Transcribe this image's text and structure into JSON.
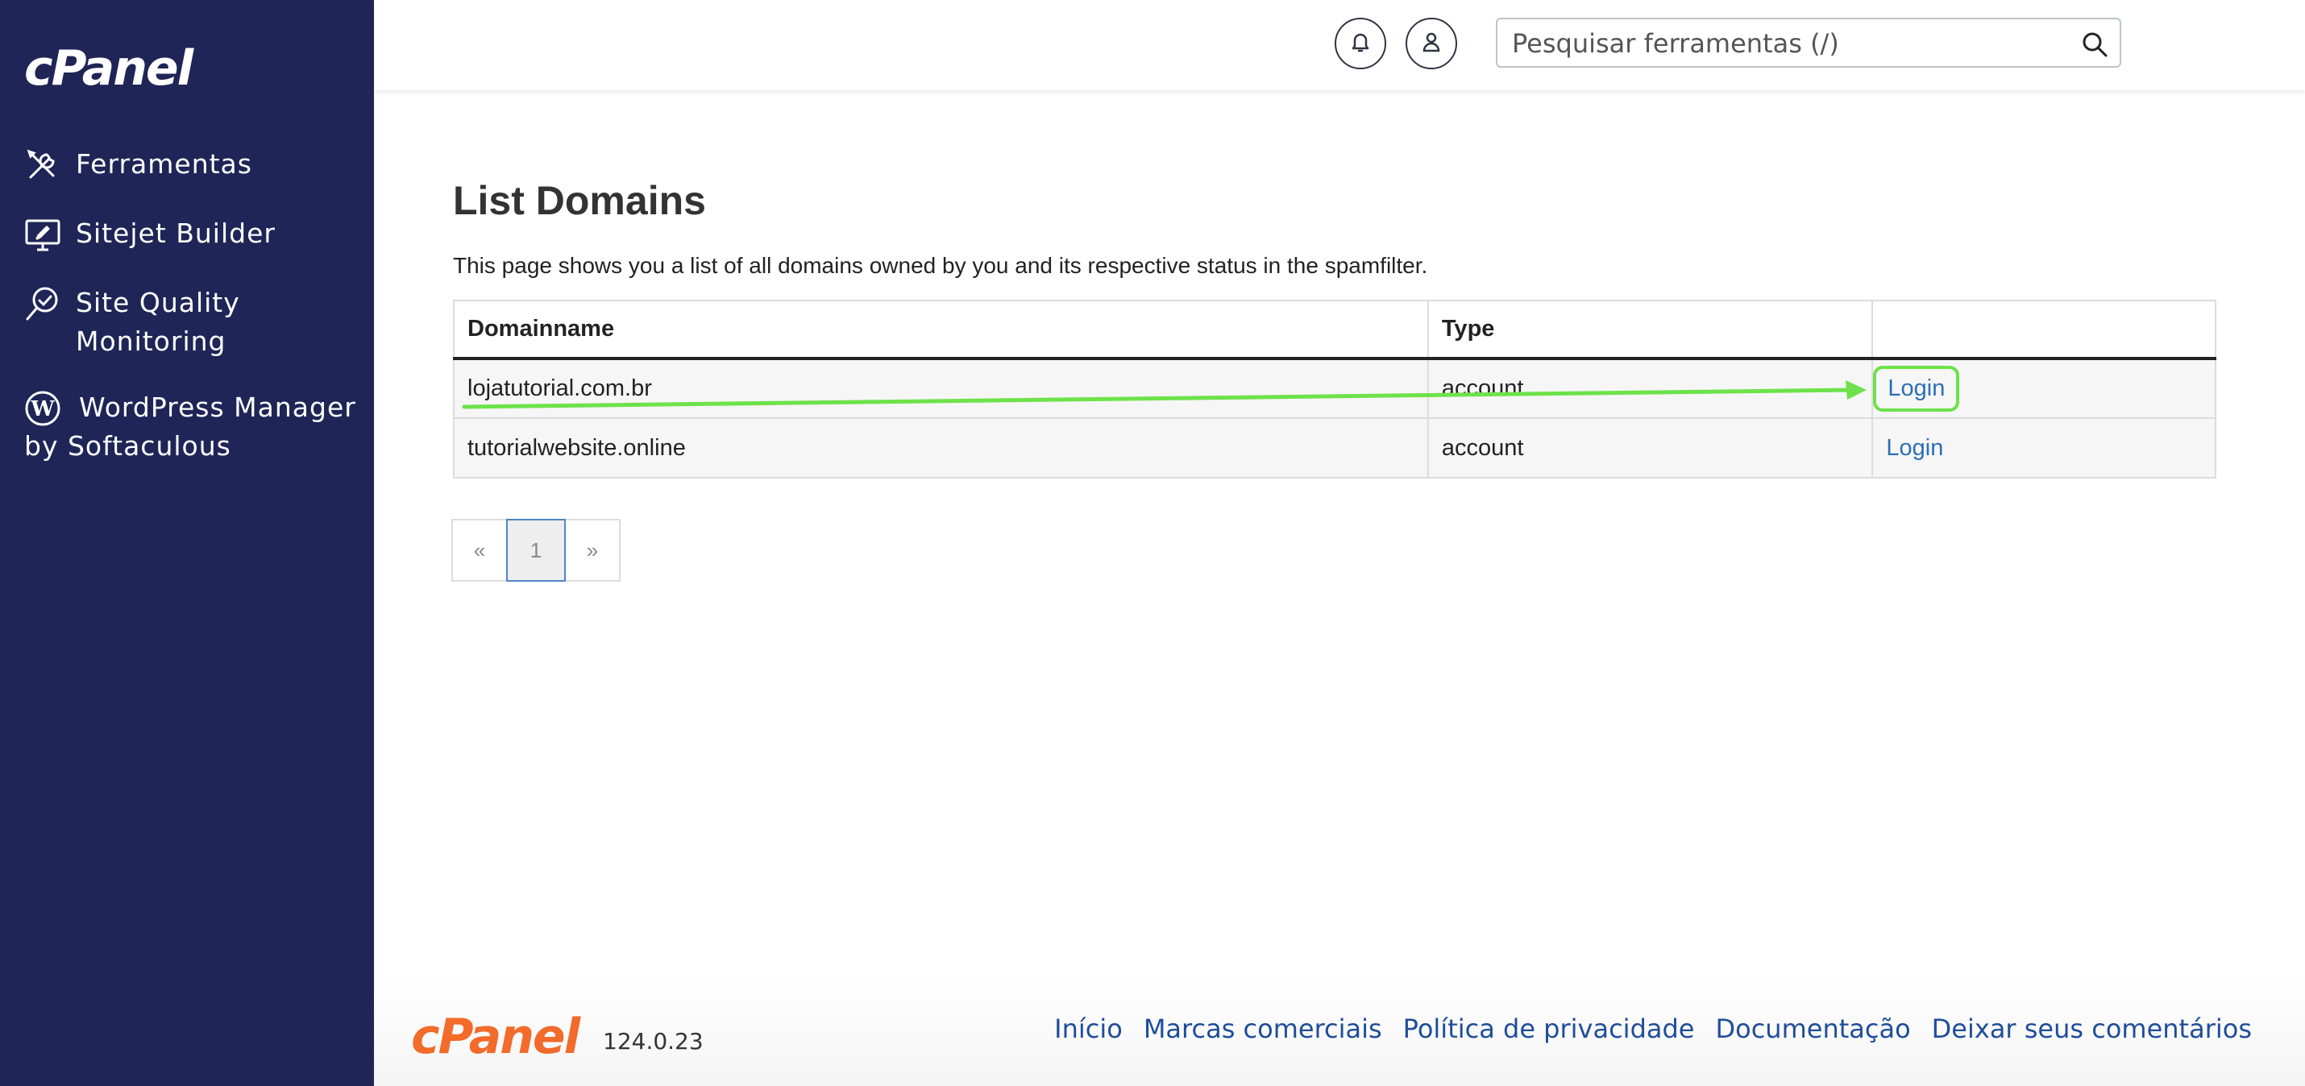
{
  "brand": {
    "logo_text": "cPanel",
    "sidebar_color": "#1f2556",
    "footer_logo_color": "#f26b2a"
  },
  "sidebar": {
    "items": [
      {
        "label": "Ferramentas",
        "icon": "tools-icon"
      },
      {
        "label": "Sitejet Builder",
        "icon": "monitor-icon"
      },
      {
        "label": "Site Quality\nMonitoring",
        "icon": "magnifier-icon"
      },
      {
        "label": "WordPress Manager by Softaculous",
        "icon": "wordpress-icon"
      }
    ]
  },
  "header": {
    "search_placeholder": "Pesquisar ferramentas (/)"
  },
  "main": {
    "title": "List Domains",
    "description": "This page shows you a list of all domains owned by you and its respective status in the spamfilter.",
    "table": {
      "headers": [
        "Domainname",
        "Type",
        ""
      ],
      "rows": [
        {
          "domain": "lojatutorial.com.br",
          "type": "account",
          "action": "Login",
          "highlighted": true
        },
        {
          "domain": "tutorialwebsite.online",
          "type": "account",
          "action": "Login",
          "highlighted": false
        }
      ]
    },
    "pagination": {
      "prev": "«",
      "current": "1",
      "next": "»"
    }
  },
  "annotation": {
    "color": "#6de24a",
    "type": "arrow"
  },
  "footer": {
    "logo_text": "cPanel",
    "version": "124.0.23",
    "links": [
      "Início",
      "Marcas comerciais",
      "Política de privacidade",
      "Documentação",
      "Deixar seus comentários"
    ]
  }
}
